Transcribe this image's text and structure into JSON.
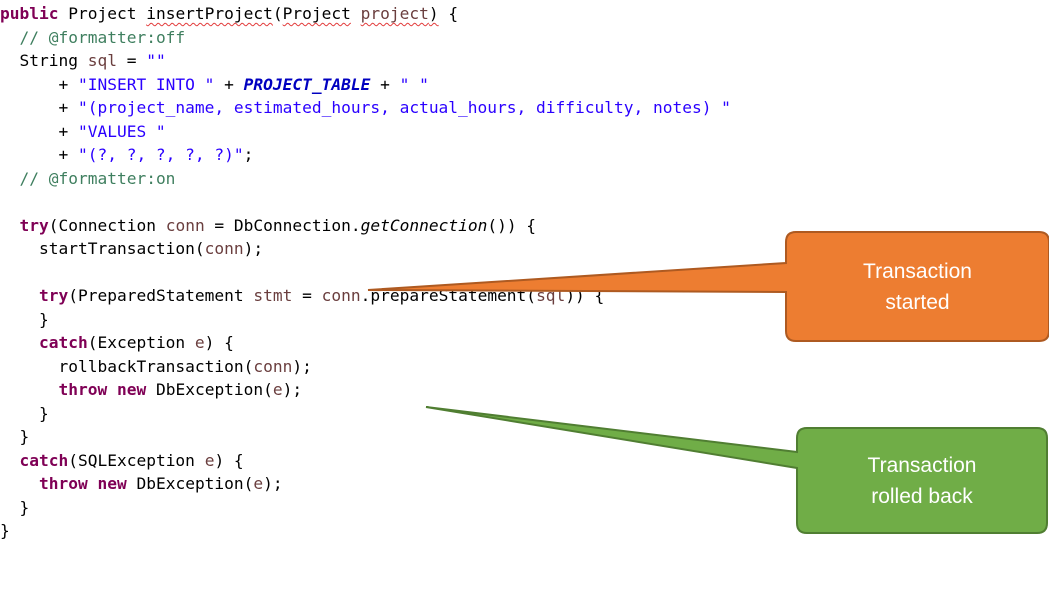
{
  "code": {
    "lines": [
      [
        {
          "t": "public",
          "c": "kw"
        },
        {
          "t": " Project "
        },
        {
          "t": "insertProject",
          "c": "squig"
        },
        {
          "t": "("
        },
        {
          "t": "Project",
          "c": "squig"
        },
        {
          "t": " "
        },
        {
          "t": "project",
          "c": "var squig"
        },
        {
          "t": ")",
          "c": "squig"
        },
        {
          "t": " {"
        }
      ],
      [
        {
          "t": "  "
        },
        {
          "t": "// @formatter:off",
          "c": "cm"
        }
      ],
      [
        {
          "t": "  String "
        },
        {
          "t": "sql",
          "c": "var"
        },
        {
          "t": " = "
        },
        {
          "t": "\"\"",
          "c": "str"
        }
      ],
      [
        {
          "t": "      + "
        },
        {
          "t": "\"INSERT INTO \"",
          "c": "str"
        },
        {
          "t": " + "
        },
        {
          "t": "PROJECT_TABLE",
          "c": "field"
        },
        {
          "t": " + "
        },
        {
          "t": "\" \"",
          "c": "str"
        }
      ],
      [
        {
          "t": "      + "
        },
        {
          "t": "\"(project_name, estimated_hours, actual_hours, difficulty, notes) \"",
          "c": "str"
        }
      ],
      [
        {
          "t": "      + "
        },
        {
          "t": "\"VALUES \"",
          "c": "str"
        }
      ],
      [
        {
          "t": "      + "
        },
        {
          "t": "\"(?, ?, ?, ?, ?)\"",
          "c": "str"
        },
        {
          "t": ";"
        }
      ],
      [
        {
          "t": "  "
        },
        {
          "t": "// @formatter:on",
          "c": "cm"
        }
      ],
      [
        {
          "t": ""
        }
      ],
      [
        {
          "t": "  "
        },
        {
          "t": "try",
          "c": "kw"
        },
        {
          "t": "(Connection "
        },
        {
          "t": "conn",
          "c": "var"
        },
        {
          "t": " = DbConnection."
        },
        {
          "t": "getConnection",
          "c": "sm"
        },
        {
          "t": "()) {"
        }
      ],
      [
        {
          "t": "    startTransaction("
        },
        {
          "t": "conn",
          "c": "var"
        },
        {
          "t": ");"
        }
      ],
      [
        {
          "t": ""
        }
      ],
      [
        {
          "t": "    "
        },
        {
          "t": "try",
          "c": "kw"
        },
        {
          "t": "(PreparedStatement "
        },
        {
          "t": "stmt",
          "c": "var"
        },
        {
          "t": " = "
        },
        {
          "t": "conn",
          "c": "var"
        },
        {
          "t": ".prepareStatement("
        },
        {
          "t": "sql",
          "c": "var"
        },
        {
          "t": ")) {"
        }
      ],
      [
        {
          "t": "    }"
        }
      ],
      [
        {
          "t": "    "
        },
        {
          "t": "catch",
          "c": "kw"
        },
        {
          "t": "(Exception "
        },
        {
          "t": "e",
          "c": "var"
        },
        {
          "t": ") {"
        }
      ],
      [
        {
          "t": "      rollbackTransaction("
        },
        {
          "t": "conn",
          "c": "var"
        },
        {
          "t": ");"
        }
      ],
      [
        {
          "t": "      "
        },
        {
          "t": "throw",
          "c": "kw"
        },
        {
          "t": " "
        },
        {
          "t": "new",
          "c": "kw"
        },
        {
          "t": " DbException("
        },
        {
          "t": "e",
          "c": "var"
        },
        {
          "t": ");"
        }
      ],
      [
        {
          "t": "    }"
        }
      ],
      [
        {
          "t": "  }"
        }
      ],
      [
        {
          "t": "  "
        },
        {
          "t": "catch",
          "c": "kw"
        },
        {
          "t": "(SQLException "
        },
        {
          "t": "e",
          "c": "var"
        },
        {
          "t": ") {"
        }
      ],
      [
        {
          "t": "    "
        },
        {
          "t": "throw",
          "c": "kw"
        },
        {
          "t": " "
        },
        {
          "t": "new",
          "c": "kw"
        },
        {
          "t": " DbException("
        },
        {
          "t": "e",
          "c": "var"
        },
        {
          "t": ");"
        }
      ],
      [
        {
          "t": "  }"
        }
      ],
      [
        {
          "t": "}"
        }
      ]
    ]
  },
  "callouts": {
    "started": {
      "text": "Transaction\nstarted",
      "fill": "#ed7d31",
      "stroke": "#ae5a21"
    },
    "rolled_back": {
      "text": "Transaction\nrolled back",
      "fill": "#70ad47",
      "stroke": "#507e32"
    }
  }
}
